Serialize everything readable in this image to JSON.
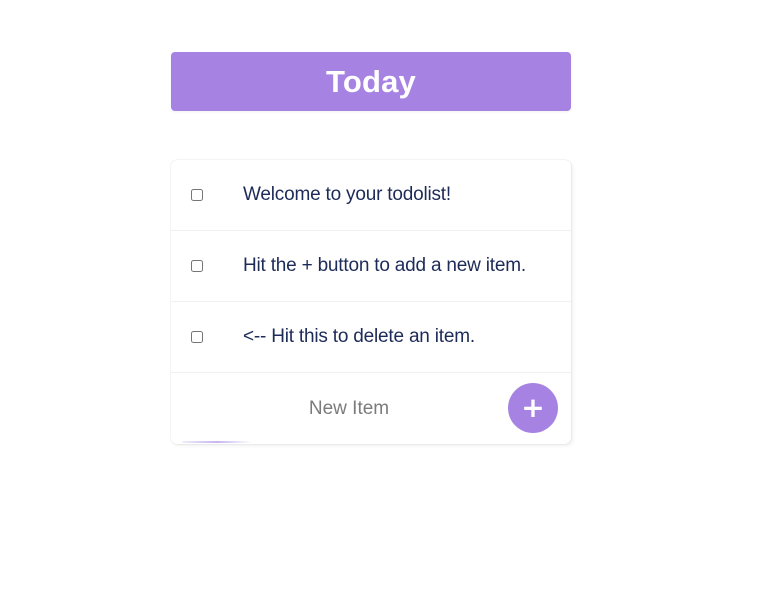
{
  "header": {
    "title": "Today"
  },
  "todo": {
    "items": [
      {
        "text": "Welcome to your todolist!",
        "checked": false
      },
      {
        "text": "Hit the + button to add a new item.",
        "checked": false
      },
      {
        "text": "<-- Hit this to delete an item.",
        "checked": false
      }
    ],
    "new_item": {
      "placeholder": "New Item",
      "value": ""
    },
    "add_button_label": "+"
  },
  "colors": {
    "accent": "#a683e3",
    "item_text": "#1d2b58",
    "placeholder_text": "#7b7b7b"
  }
}
